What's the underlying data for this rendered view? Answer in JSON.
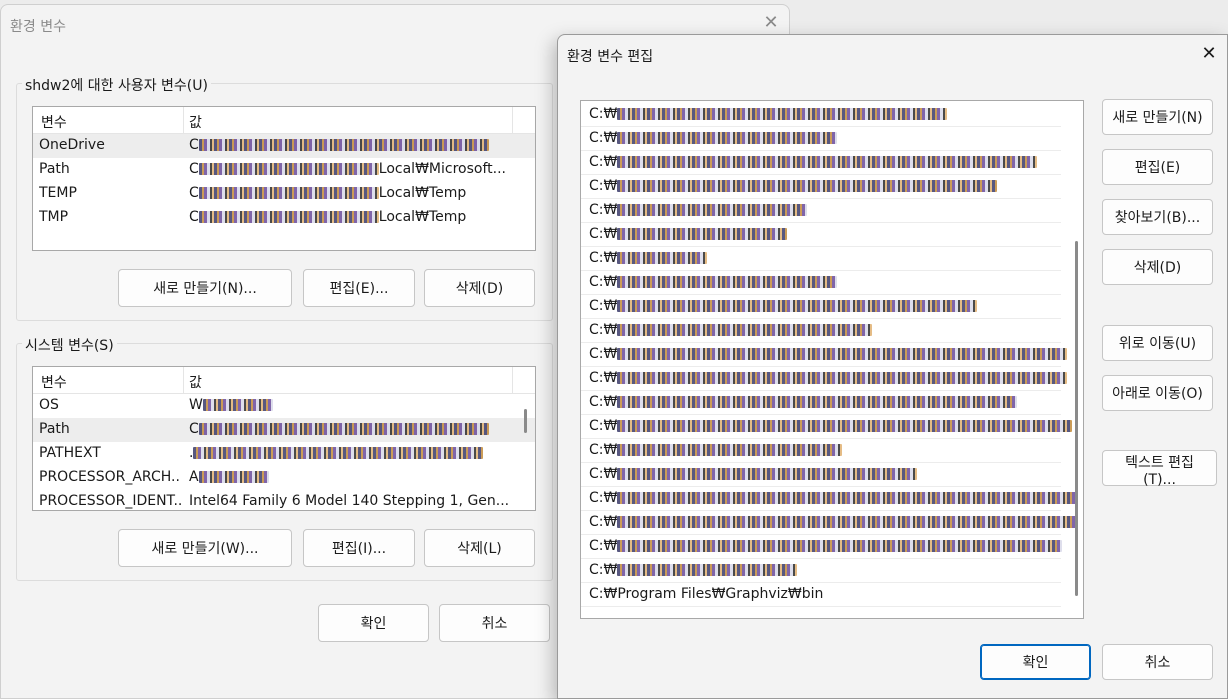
{
  "back_dialog": {
    "title": "환경 변수",
    "close_glyph": "✕",
    "user_group_label": "shdw2에 대한 사용자 변수(U)",
    "system_group_label": "시스템 변수(S)",
    "col_name": "변수",
    "col_value": "값",
    "user_vars": [
      {
        "name": "OneDrive",
        "prefix": "C",
        "suffix": ""
      },
      {
        "name": "Path",
        "prefix": "C",
        "suffix": "Local₩Microsoft..."
      },
      {
        "name": "TEMP",
        "prefix": "C",
        "suffix": "Local₩Temp"
      },
      {
        "name": "TMP",
        "prefix": "C",
        "suffix": "Local₩Temp"
      }
    ],
    "system_vars": [
      {
        "name": "OS",
        "prefix": "W",
        "suffix": ""
      },
      {
        "name": "Path",
        "prefix": "C",
        "suffix": ""
      },
      {
        "name": "PATHEXT",
        "prefix": ".",
        "suffix": ""
      },
      {
        "name": "PROCESSOR_ARCH...",
        "prefix": "A",
        "suffix": ""
      },
      {
        "name": "PROCESSOR_IDENT...",
        "prefix": "",
        "suffix": "Intel64 Family 6 Model 140 Stepping 1, Gen..."
      }
    ],
    "user_buttons": {
      "new": "새로 만들기(N)...",
      "edit": "편집(E)...",
      "delete": "삭제(D)"
    },
    "system_buttons": {
      "new": "새로 만들기(W)...",
      "edit": "편집(I)...",
      "delete": "삭제(L)"
    },
    "ok": "확인",
    "cancel": "취소"
  },
  "edit_dialog": {
    "title": "환경 변수 편집",
    "close_glyph": "✕",
    "path_prefix": "C:₩",
    "paths": [
      {
        "text": "",
        "blur": 330
      },
      {
        "text": "",
        "blur": 220
      },
      {
        "text": "",
        "blur": 420
      },
      {
        "text": "",
        "blur": 380
      },
      {
        "text": "",
        "blur": 190
      },
      {
        "text": "",
        "blur": 170
      },
      {
        "text": "",
        "blur": 90
      },
      {
        "text": "",
        "blur": 220
      },
      {
        "text": "",
        "blur": 360
      },
      {
        "text": "",
        "blur": 255
      },
      {
        "text": "",
        "blur": 450
      },
      {
        "text": "",
        "blur": 450
      },
      {
        "text": "",
        "blur": 400
      },
      {
        "text": "",
        "blur": 455
      },
      {
        "text": "",
        "blur": 225
      },
      {
        "text": "",
        "blur": 300
      },
      {
        "text": "",
        "blur": 460
      },
      {
        "text": "",
        "blur": 460
      },
      {
        "text": "",
        "blur": 445
      },
      {
        "text": "",
        "blur": 180
      },
      {
        "text": "Program Files₩Graphviz₩bin",
        "blur": 0
      }
    ],
    "buttons": {
      "new": "새로 만들기(N)",
      "edit": "편집(E)",
      "browse": "찾아보기(B)...",
      "delete": "삭제(D)",
      "move_up": "위로 이동(U)",
      "move_down": "아래로 이동(O)",
      "edit_text": "텍스트 편집(T)..."
    },
    "ok": "확인",
    "cancel": "취소"
  }
}
